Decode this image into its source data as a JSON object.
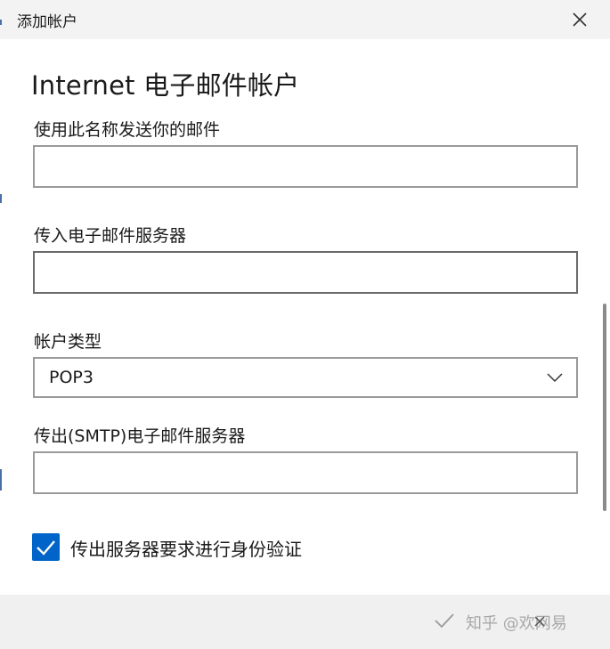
{
  "window": {
    "title": "添加帐户"
  },
  "form": {
    "heading": "Internet 电子邮件帐户",
    "send_name_label": "使用此名称发送你的邮件",
    "send_name_value": "",
    "incoming_server_label": "传入电子邮件服务器",
    "incoming_server_value": "",
    "account_type_label": "帐户类型",
    "account_type_value": "POP3",
    "outgoing_server_label": "传出(SMTP)电子邮件服务器",
    "outgoing_server_value": "",
    "auth_checkbox_label": "传出服务器要求进行身份验证",
    "auth_checkbox_checked": true
  },
  "footer": {
    "watermark_text": "知乎 @欢网易"
  },
  "colors": {
    "accent": "#0064c8",
    "titlebar_bg": "#f3f3f3",
    "footer_bg": "#f0f0f0"
  },
  "icons": {
    "close": "close-icon",
    "chevron": "chevron-down-icon",
    "check": "checkmark-icon",
    "confirm": "checkmark-icon",
    "cancel": "close-icon"
  }
}
